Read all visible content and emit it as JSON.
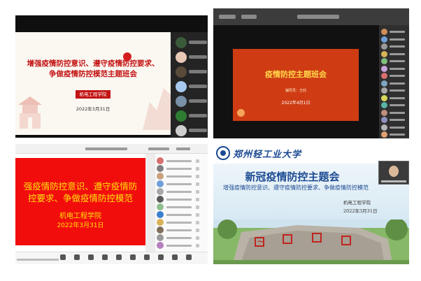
{
  "panel1": {
    "slide_title_line1": "增强疫情防控意识、遵守疫情防控要求、",
    "slide_title_line2": "争做疫情防控模范主题班会",
    "school_tag": "机电工程学院",
    "date": "2022年3月31日",
    "participant_colors": [
      "#3b5a3a",
      "#e7c9b6",
      "#5a4a3a",
      "#a8c9ef",
      "#7a8fa8",
      "#2e7d32",
      "#cfcfcf"
    ]
  },
  "panel2": {
    "slide_title": "疫情防控主题班会",
    "presenter": "辅导员：王欣",
    "date": "2022年4月1日",
    "participant_colors": [
      "#cf8f5a",
      "#6f9fd8",
      "#9a9a9a",
      "#d8b25a",
      "#7fbf7f",
      "#c9a2d8",
      "#d86f6f",
      "#7fa5bf",
      "#a8a8a8",
      "#d8d85a",
      "#5ab5a5",
      "#bf8f7f",
      "#8f8fbf",
      "#b5b5b5",
      "#e09f6f"
    ]
  },
  "panel3": {
    "slide_title_line1": "强疫情防控意识、遵守疫情防",
    "slide_title_line2": "控要求、争做疫情防控模范",
    "org": "机电工程学院",
    "date": "2022年3月31日",
    "participant_colors": [
      "#d86f6f",
      "#7f7f7f",
      "#c9a27f",
      "#6f9fd8",
      "#a8a8a8",
      "#5a5a5a",
      "#8fbf8f",
      "#3a7fd0",
      "#d8b25a",
      "#7f6f5a",
      "#9a9a9a",
      "#b57fbf"
    ]
  },
  "panel4": {
    "university_name": "郑州轻工业大学",
    "title": "新冠疫情防控主题会",
    "subtitle": "增强疫情防控意识、遵守疫情防控要求、争做疫情防控模范",
    "org": "机电工程学院",
    "date": "2022年3月31日",
    "brand_color": "#1b4a92"
  }
}
